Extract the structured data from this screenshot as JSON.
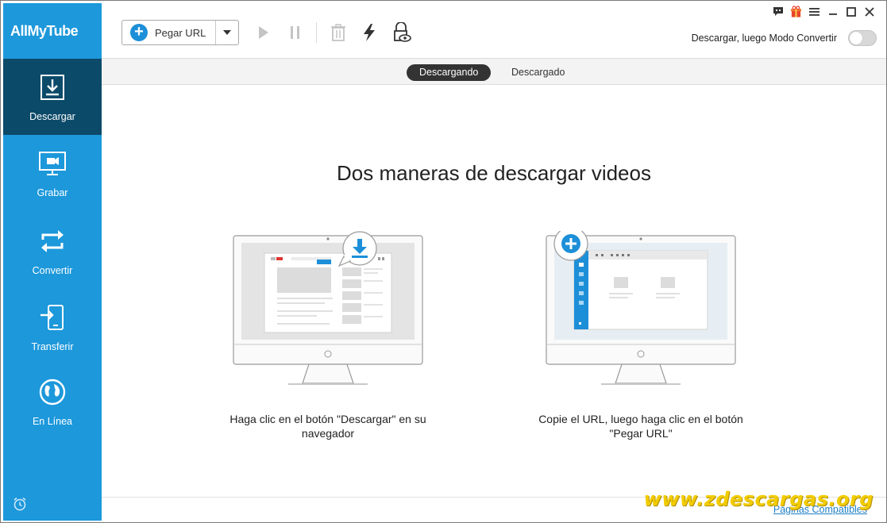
{
  "app": {
    "title": "AllMyTube"
  },
  "sidebar": {
    "items": [
      {
        "label": "Descargar",
        "icon": "download-icon",
        "active": true
      },
      {
        "label": "Grabar",
        "icon": "record-screen-icon",
        "active": false
      },
      {
        "label": "Convertir",
        "icon": "convert-icon",
        "active": false
      },
      {
        "label": "Transferir",
        "icon": "transfer-icon",
        "active": false
      },
      {
        "label": "En Línea",
        "icon": "globe-icon",
        "active": false
      }
    ],
    "bottom_icon": "alarm-icon"
  },
  "toolbar": {
    "paste_url_label": "Pegar URL",
    "icons": [
      "play-icon",
      "pause-icon",
      "trash-icon",
      "turbo-icon",
      "private-mode-icon"
    ],
    "window_icons": [
      "feedback-icon",
      "gift-icon",
      "menu-icon",
      "minimize-icon",
      "maximize-icon",
      "close-icon"
    ],
    "mode_label": "Descargar, luego Modo Convertir",
    "mode_enabled": false
  },
  "tabs": [
    {
      "label": "Descargando",
      "active": true
    },
    {
      "label": "Descargado",
      "active": false
    }
  ],
  "main": {
    "headline": "Dos maneras de descargar videos",
    "cards": [
      {
        "caption_line1": "Haga clic en el botón \"Descargar\" en su",
        "caption_line2": "navegador"
      },
      {
        "caption_line1": "Copie el URL, luego haga clic en el botón",
        "caption_line2": "\"Pegar URL\""
      }
    ]
  },
  "footer": {
    "link": "Páginas Compatibles",
    "watermark": "www.zdescargas.org"
  },
  "colors": {
    "sidebar": "#1d98db",
    "sidebar_active": "#0c4a6a",
    "accent": "#1d8fd8",
    "watermark": "#f2cc00"
  }
}
